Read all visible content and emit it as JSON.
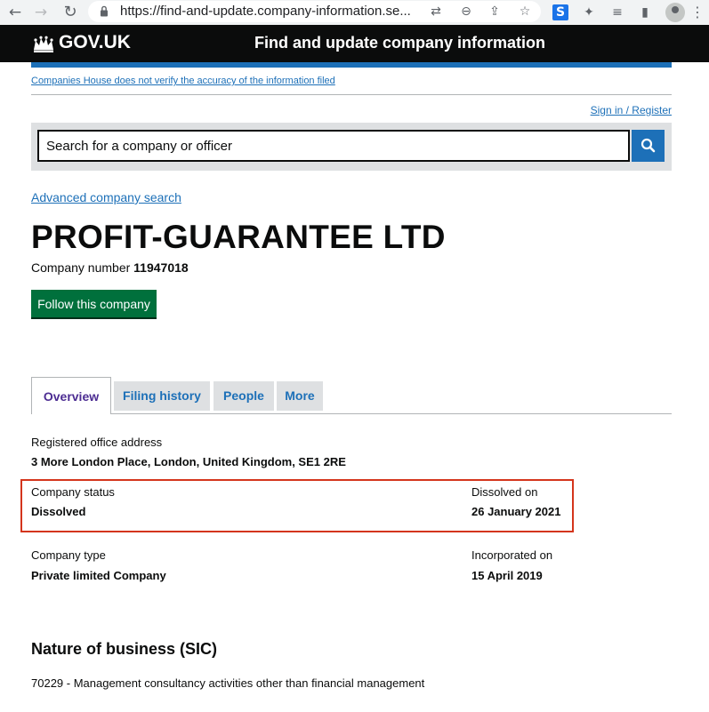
{
  "browser": {
    "url": "https://find-and-update.company-information.se..."
  },
  "header": {
    "logo_text": "GOV.UK",
    "service_name": "Find and update company information"
  },
  "disclaimer": "Companies House does not verify the accuracy of the information filed",
  "sign_in": "Sign in / Register",
  "search": {
    "placeholder": "Search for a company or officer"
  },
  "advanced_search": "Advanced company search",
  "company": {
    "name": "PROFIT-GUARANTEE LTD",
    "number_label": "Company number",
    "number": "11947018",
    "follow_label": "Follow this company"
  },
  "tabs": [
    {
      "label": "Overview"
    },
    {
      "label": "Filing history"
    },
    {
      "label": "People"
    },
    {
      "label": "More"
    }
  ],
  "overview": {
    "office_label": "Registered office address",
    "office_value": "3 More London Place, London, United Kingdom, SE1 2RE",
    "status_label": "Company status",
    "status_value": "Dissolved",
    "dissolved_label": "Dissolved on",
    "dissolved_value": "26 January 2021",
    "type_label": "Company type",
    "type_value": "Private limited Company",
    "incorporated_label": "Incorporated on",
    "incorporated_value": "15 April 2019"
  },
  "sic": {
    "heading": "Nature of business (SIC)",
    "entry": "70229 - Management consultancy activities other than financial management"
  },
  "colors": {
    "link": "#1d70b8",
    "govuk_black": "#0b0c0c",
    "button_green": "#00703c",
    "highlight_red": "#d4351c",
    "active_tab": "#4c2c92"
  }
}
